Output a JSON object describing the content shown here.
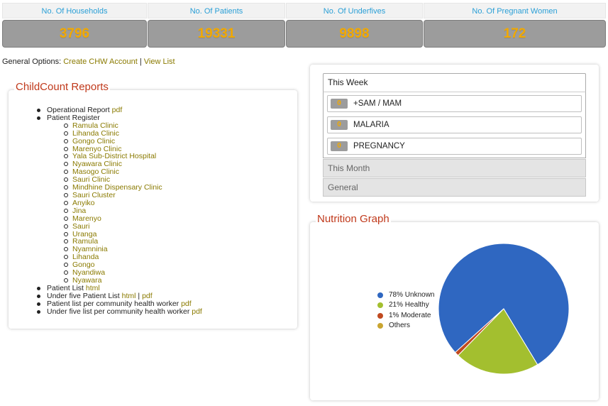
{
  "stats": [
    {
      "label": "No. Of Households",
      "value": "3796"
    },
    {
      "label": "No. Of Patients",
      "value": "19331"
    },
    {
      "label": "No. Of Underfives",
      "value": "9898"
    },
    {
      "label": "No. Of Pregnant Women",
      "value": "172"
    }
  ],
  "general_options": {
    "label": "General Options:",
    "create_link": "Create CHW Account",
    "separator": "|",
    "view_link": "View List"
  },
  "reports": {
    "title": "ChildCount Reports",
    "operational": {
      "label": "Operational Report",
      "pdf": "pdf"
    },
    "patient_register": {
      "label": "Patient Register",
      "locations": [
        "Ramula Clinic",
        "Lihanda Clinic",
        "Gongo Clinic",
        "Marenyo Clinic",
        "Yala Sub-District Hospital",
        "Nyawara Clinic",
        "Masogo Clinic",
        "Sauri Clinic",
        "Mindhine Dispensary Clinic",
        "Sauri Cluster",
        "Anyiko",
        "Jina",
        "Marenyo",
        "Sauri",
        "Uranga",
        "Ramula",
        "Nyamninia",
        "Lihanda",
        "Gongo",
        "Nyandiwa",
        "Nyawara"
      ]
    },
    "patient_list": {
      "label": "Patient List",
      "html": "html"
    },
    "under_five": {
      "label": "Under five Patient List",
      "html": "html",
      "sep": "|",
      "pdf": "pdf"
    },
    "per_chw": {
      "label": "Patient list per community health worker",
      "pdf": "pdf"
    },
    "under_five_chw": {
      "label": "Under five list per community health worker",
      "pdf": "pdf"
    }
  },
  "summary": {
    "this_week": "This Week",
    "items": [
      {
        "count": "0",
        "label": "+SAM / MAM"
      },
      {
        "count": "0",
        "label": "MALARIA"
      },
      {
        "count": "0",
        "label": "PREGNANCY"
      }
    ],
    "this_month": "This Month",
    "general": "General"
  },
  "nutrition": {
    "title": "Nutrition Graph"
  },
  "chart_data": {
    "type": "pie",
    "slices": [
      {
        "label": "78% Unknown",
        "value": 78,
        "color": "#2f67c1"
      },
      {
        "label": "21% Healthy",
        "value": 21,
        "color": "#a3bf2f"
      },
      {
        "label": "1% Moderate",
        "value": 1,
        "color": "#c04a20"
      },
      {
        "label": "Others",
        "value": 0,
        "color": "#c9a531"
      }
    ],
    "legend_position": "left"
  }
}
